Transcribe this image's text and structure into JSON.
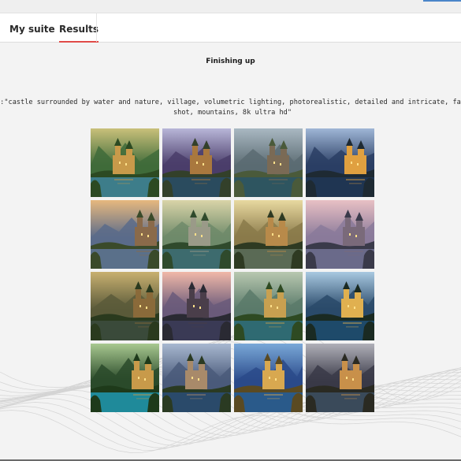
{
  "tabs": [
    {
      "label": "My suite",
      "active": false
    },
    {
      "label": "Results",
      "active": true
    }
  ],
  "status_text": "Finishing up",
  "prompt": {
    "line1": "t:\"castle surrounded by water and nature, village, volumetric lighting, photorealistic, detailed and intricate, fant",
    "line2": "shot, mountains, 8k ultra hd\""
  },
  "accent_color": "#e04b48",
  "images": [
    {
      "sky": "#c9c07a",
      "sky2": "#3f6b3a",
      "water": "#3d7d8a",
      "land": "#2c4a22",
      "castle": "#c89a4a"
    },
    {
      "sky": "#b8b6d8",
      "sky2": "#4a3d6a",
      "water": "#2a4b5e",
      "land": "#33402a",
      "castle": "#a9783e"
    },
    {
      "sky": "#a9b8c2",
      "sky2": "#5b6b72",
      "water": "#2e5560",
      "land": "#4a5a3a",
      "castle": "#7a6a55"
    },
    {
      "sky": "#9fb6d6",
      "sky2": "#2a3e64",
      "water": "#1f3552",
      "land": "#1e2a33",
      "castle": "#e0a040"
    },
    {
      "sky": "#e6b87e",
      "sky2": "#5a6b8a",
      "water": "#5a708a",
      "land": "#3a4a2a",
      "castle": "#8a6a4a"
    },
    {
      "sky": "#d9d4a8",
      "sky2": "#6e8a6a",
      "water": "#3d6b6e",
      "land": "#2f4a2c",
      "castle": "#9a9a88"
    },
    {
      "sky": "#e8d9a0",
      "sky2": "#8a7a4a",
      "water": "#5a6a55",
      "land": "#2e3a22",
      "castle": "#b88a4a"
    },
    {
      "sky": "#e8c0c4",
      "sky2": "#8a7a9a",
      "water": "#6a6a8a",
      "land": "#3a3a4a",
      "castle": "#7a6a7a"
    },
    {
      "sky": "#c8b070",
      "sky2": "#5a5a3a",
      "water": "#3a4a3a",
      "land": "#2a3a1e",
      "castle": "#8a6a3a"
    },
    {
      "sky": "#f0b8a8",
      "sky2": "#6a5a7a",
      "water": "#3a3a55",
      "land": "#2a2a33",
      "castle": "#4a3e4a"
    },
    {
      "sky": "#b8c8b0",
      "sky2": "#5a7a6a",
      "water": "#2f6a72",
      "land": "#2e4a22",
      "castle": "#c8a050"
    },
    {
      "sky": "#a8c8e0",
      "sky2": "#2a4a6a",
      "water": "#1e4a6a",
      "land": "#1a2a22",
      "castle": "#e0b050"
    },
    {
      "sky": "#a8c890",
      "sky2": "#2a4a2a",
      "water": "#1f8a9a",
      "land": "#1e3a1a",
      "castle": "#c89a4a"
    },
    {
      "sky": "#a8b8d0",
      "sky2": "#4a5a7a",
      "water": "#2a4a6a",
      "land": "#2a3a22",
      "castle": "#a88a6a"
    },
    {
      "sky": "#7aa8d8",
      "sky2": "#2a4a8a",
      "water": "#2a5a8a",
      "land": "#5a4a22",
      "castle": "#d8a850"
    },
    {
      "sky": "#b0b0b8",
      "sky2": "#3a3a48",
      "water": "#3a4a5a",
      "land": "#2a2a22",
      "castle": "#c8904a"
    }
  ]
}
